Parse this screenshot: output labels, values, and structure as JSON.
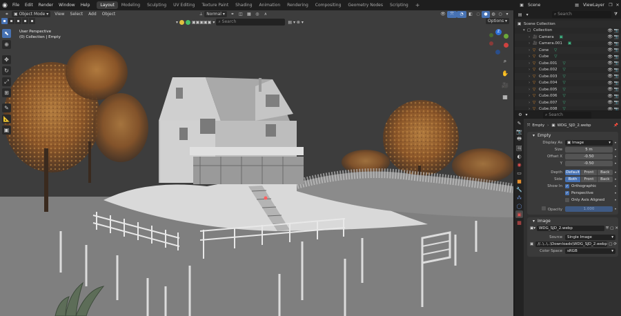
{
  "topbar": {
    "menus": [
      "File",
      "Edit",
      "Render",
      "Window",
      "Help"
    ],
    "workspaces": [
      "Layout",
      "Modeling",
      "Sculpting",
      "UV Editing",
      "Texture Paint",
      "Shading",
      "Animation",
      "Rendering",
      "Compositing",
      "Geometry Nodes",
      "Scripting"
    ],
    "active_workspace": "Layout",
    "scene": "Scene",
    "view_layer": "ViewLayer"
  },
  "viewport": {
    "mode": "Object Mode",
    "menus": [
      "View",
      "Select",
      "Add",
      "Object"
    ],
    "orientation": "Normal",
    "search_placeholder": "Search",
    "options": "Options",
    "info_line1": "User Perspective",
    "info_line2": "(0) Collection | Empty",
    "gizmo_z": "Z"
  },
  "outliner": {
    "search_placeholder": "Search",
    "rows": [
      {
        "label": "Scene Collection",
        "indent": 0,
        "kind": "scene"
      },
      {
        "label": "Collection",
        "indent": 1,
        "kind": "collection"
      },
      {
        "label": "Camera",
        "indent": 2,
        "kind": "camera"
      },
      {
        "label": "Camera.001",
        "indent": 2,
        "kind": "camera"
      },
      {
        "label": "Cone",
        "indent": 2,
        "kind": "mesh"
      },
      {
        "label": "Cube",
        "indent": 2,
        "kind": "mesh"
      },
      {
        "label": "Cube.001",
        "indent": 2,
        "kind": "mesh"
      },
      {
        "label": "Cube.002",
        "indent": 2,
        "kind": "mesh"
      },
      {
        "label": "Cube.003",
        "indent": 2,
        "kind": "mesh"
      },
      {
        "label": "Cube.004",
        "indent": 2,
        "kind": "mesh"
      },
      {
        "label": "Cube.005",
        "indent": 2,
        "kind": "mesh"
      },
      {
        "label": "Cube.006",
        "indent": 2,
        "kind": "mesh"
      },
      {
        "label": "Cube.007",
        "indent": 2,
        "kind": "mesh"
      },
      {
        "label": "Cube.008",
        "indent": 2,
        "kind": "mesh"
      }
    ]
  },
  "properties": {
    "search_placeholder": "Search",
    "object_name": "Empty",
    "data_name": "WDG_SJD_2.webp",
    "empty_panel": {
      "title": "Empty",
      "display_as_label": "Display As",
      "display_as": "Image",
      "size_label": "Size",
      "size": "5 m",
      "offset_x_label": "Offset X",
      "offset_x": "-0.50",
      "offset_y_label": "Y",
      "offset_y": "-0.50",
      "depth_label": "Depth",
      "depth_options": [
        "Default",
        "Front",
        "Back"
      ],
      "depth_active": 0,
      "side_label": "Side",
      "side_options": [
        "Both",
        "Front",
        "Back"
      ],
      "side_active": 0,
      "show_in_label": "Show In",
      "orthographic": "Orthographic",
      "perspective": "Perspective",
      "only_axis_aligned": "Only Axis Aligned",
      "opacity_label": "Opacity",
      "opacity": "1.000"
    },
    "image_panel": {
      "title": "Image",
      "image_name": "WDG_SJD_2.webp",
      "source_label": "Source",
      "source": "Single Image",
      "filepath": "//..\\..\\..\\Downloads\\WDG_SJD_2.webp",
      "color_space_label": "Color Space",
      "color_space": "sRGB"
    }
  },
  "colors": {
    "accent_blue": "#4772b3",
    "viewport_bg": "#3d3d3d",
    "panel_bg": "#303030"
  }
}
